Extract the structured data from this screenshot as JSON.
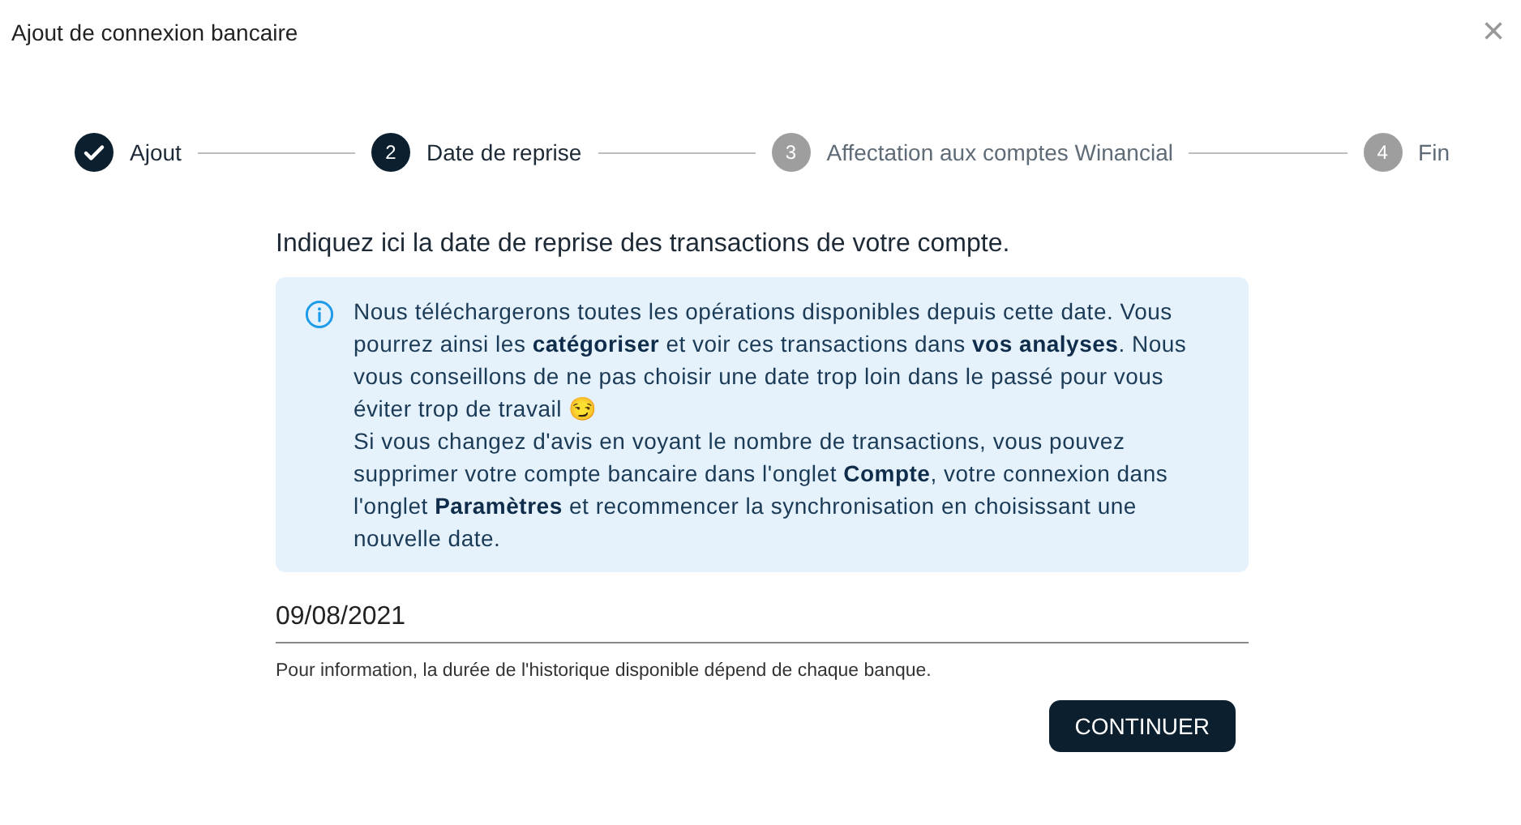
{
  "dialog": {
    "title": "Ajout de connexion bancaire",
    "close": "×"
  },
  "steps": [
    {
      "label": "Ajout",
      "kind": "done"
    },
    {
      "number": "2",
      "label": "Date de reprise",
      "kind": "active"
    },
    {
      "number": "3",
      "label": "Affectation aux comptes Winancial",
      "kind": "pending"
    },
    {
      "number": "4",
      "label": "Fin",
      "kind": "pending"
    }
  ],
  "intro": "Indiquez ici la date de reprise des transactions de votre compte.",
  "info": {
    "paragraphs": [
      "Nous téléchargerons toutes les opérations disponibles depuis cette date. Vous pourrez ainsi les **catégoriser** et voir ces transactions dans **vos analyses**. Nous vous conseillons de ne pas choisir une date trop loin dans le passé pour vous éviter trop de travail 😏",
      "Si vous changez d'avis en voyant le nombre de transactions, vous pouvez supprimer votre compte bancaire dans l'onglet **Compte**, votre connexion dans l'onglet **Paramètres** et recommencer la synchronisation en choisissant une nouvelle date."
    ]
  },
  "date_field": {
    "value": "09/08/2021",
    "helper": "Pour information, la durée de l'historique disponible dépend de chaque banque."
  },
  "buttons": [
    "CONTINUER"
  ]
}
